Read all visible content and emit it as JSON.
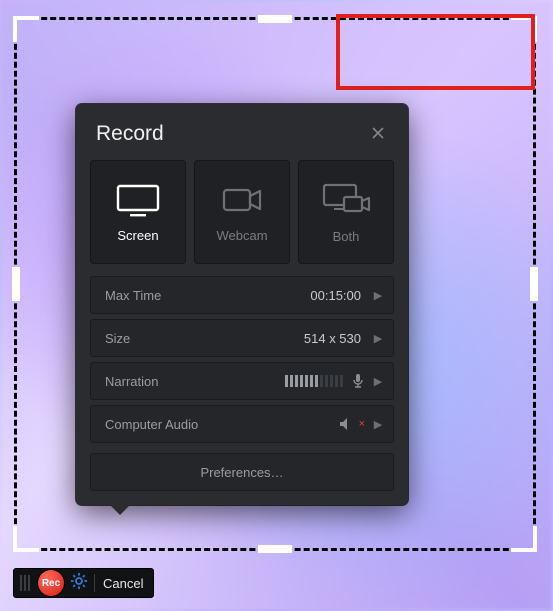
{
  "panel": {
    "title": "Record",
    "modes": {
      "screen": "Screen",
      "webcam": "Webcam",
      "both": "Both",
      "selected": "screen"
    },
    "rows": {
      "maxtime": {
        "label": "Max Time",
        "value": "00:15:00"
      },
      "size": {
        "label": "Size",
        "value": "514 x 530"
      },
      "narration": {
        "label": "Narration"
      },
      "audio": {
        "label": "Computer Audio",
        "muted": "×"
      }
    },
    "preferences": "Preferences…"
  },
  "toolbar": {
    "rec": "Rec",
    "cancel": "Cancel"
  },
  "colors": {
    "accent_red": "#d41e12",
    "highlight_box": "#e02020",
    "gear_blue": "#2e7bd6"
  }
}
